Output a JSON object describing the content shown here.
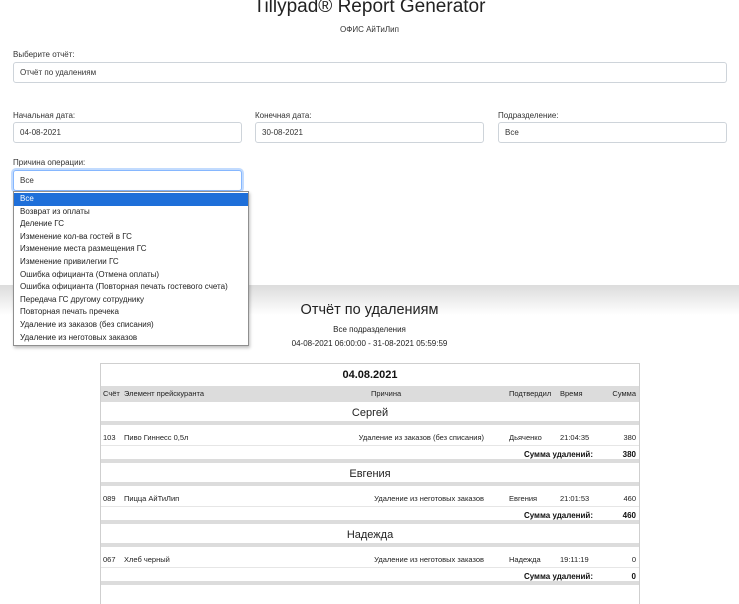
{
  "header": {
    "title": "Tillypad® Report Generator",
    "subtitle": "ОФИС АйТиЛип"
  },
  "form": {
    "report_label": "Выберите отчёт:",
    "report_value": "Отчёт по удалениям",
    "start_label": "Начальная дата:",
    "start_value": "04-08-2021",
    "end_label": "Конечная дата:",
    "end_value": "30-08-2021",
    "division_label": "Подразделение:",
    "division_value": "Все",
    "reason_label": "Причина операции:",
    "reason_value": "Все"
  },
  "dropdown": {
    "options": [
      "Все",
      "Возврат из оплаты",
      "Деление ГС",
      "Изменение кол-ва гостей в ГС",
      "Изменение места размещения ГС",
      "Изменение привилегии ГС",
      "Ошибка официанта (Отмена оплаты)",
      "Ошибка официанта (Повторная печать гостевого счета)",
      "Передача ГС другому сотруднику",
      "Повторная печать пречека",
      "Удаление из заказов (без списания)",
      "Удаление из неготовых заказов"
    ],
    "selected_index": 0
  },
  "report": {
    "title": "Отчёт по удалениям",
    "division": "Все подразделения",
    "period": "04-08-2021 06:00:00 - 31-08-2021 05:59:59",
    "date": "04.08.2021",
    "columns": {
      "check": "Счёт",
      "item": "Элемент прейскуранта",
      "reason": "Причина",
      "confirmed": "Подтвердил",
      "time": "Время",
      "sum": "Сумма"
    },
    "total_label": "Сумма удалений:",
    "groups": [
      {
        "name": "Сергей",
        "check": "103",
        "item": "Пиво Гиннесс 0,5л",
        "reason": "Удаление из заказов (без списания)",
        "confirmed": "Дьяченко",
        "time": "21:04:35",
        "sum": "380",
        "total": "380"
      },
      {
        "name": "Евгения",
        "check": "089",
        "item": "Пицца АйТиЛип",
        "reason": "Удаление из неготовых заказов",
        "confirmed": "Евгения",
        "time": "21:01:53",
        "sum": "460",
        "total": "460"
      },
      {
        "name": "Надежда",
        "check": "067",
        "item": "Хлеб черный",
        "reason": "Удаление из неготовых заказов",
        "confirmed": "Надежда",
        "time": "19:11:19",
        "sum": "0",
        "total": "0"
      }
    ]
  }
}
